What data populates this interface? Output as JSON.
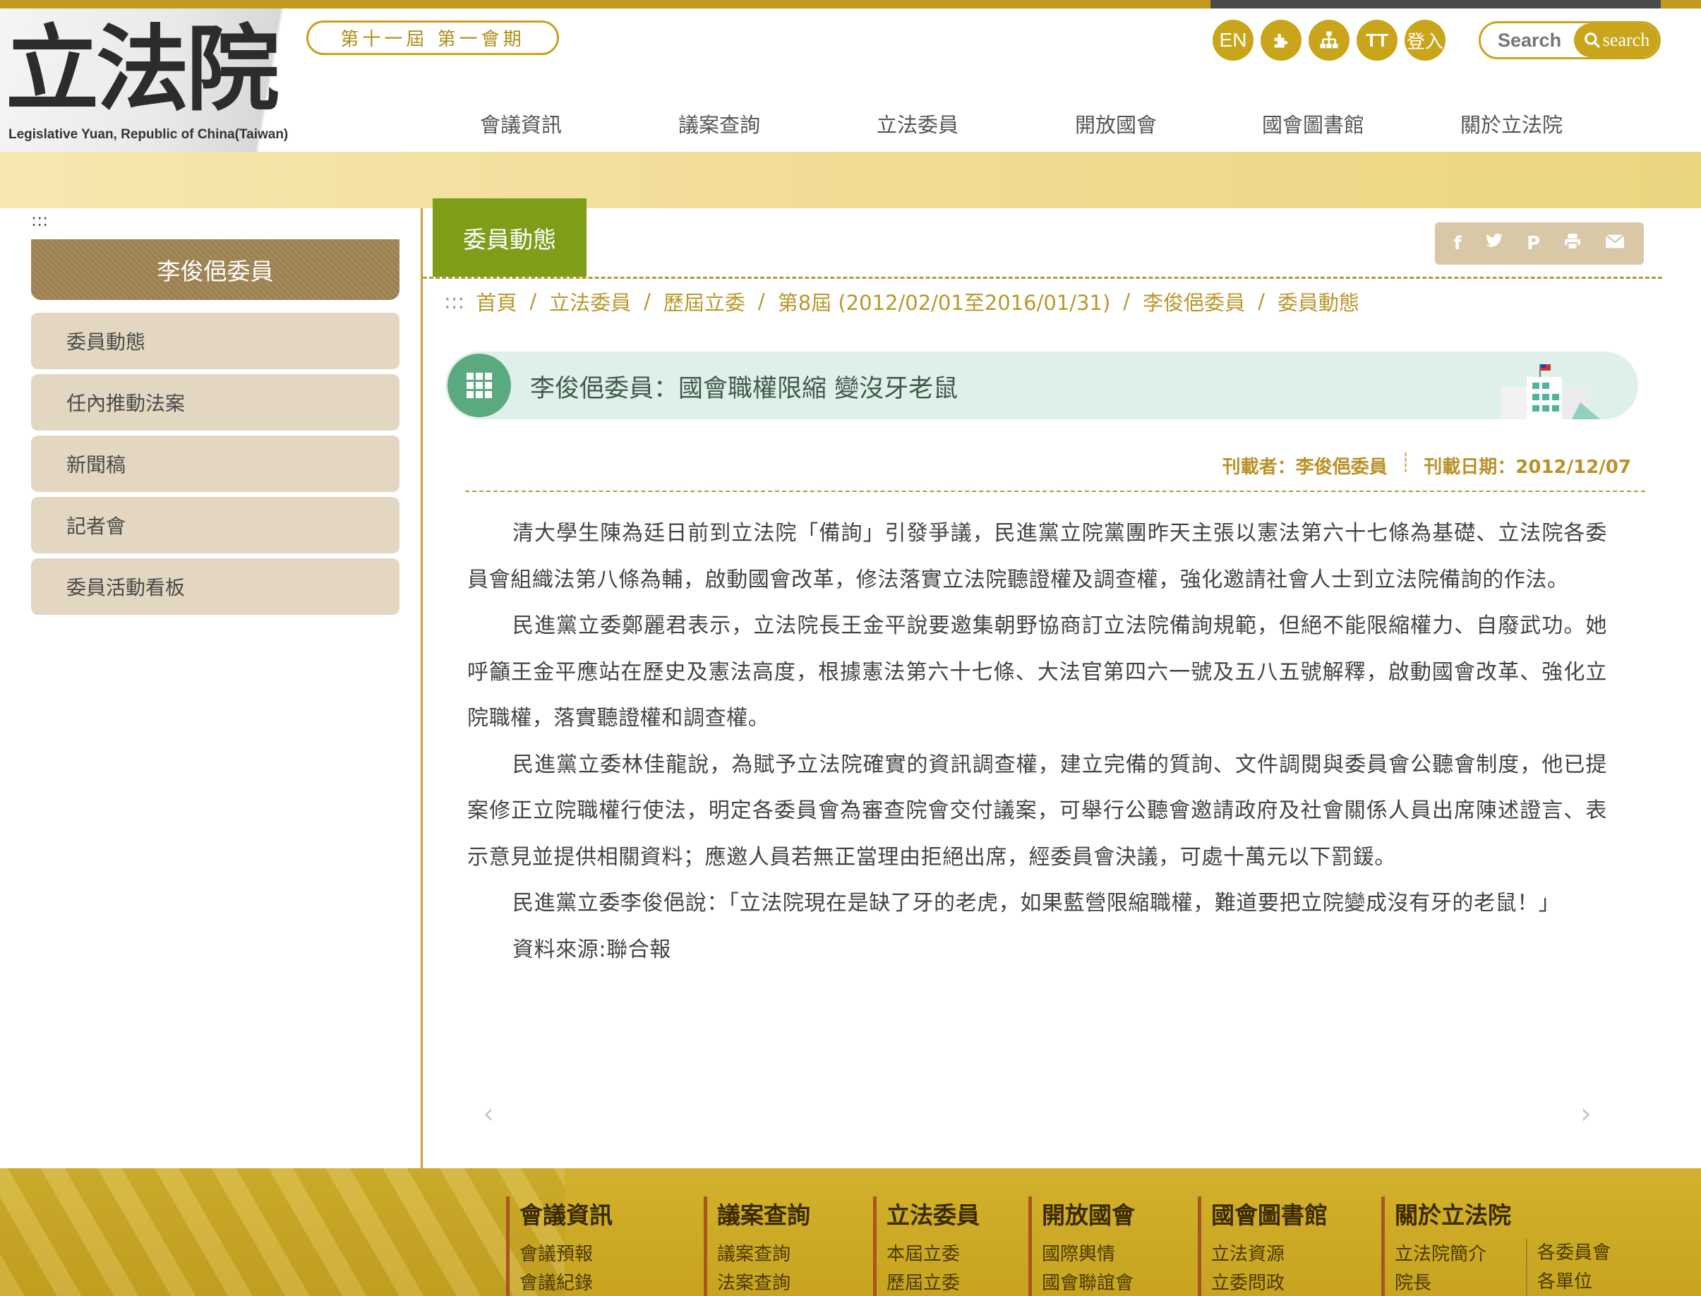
{
  "logo": {
    "chars": "立法院",
    "subtitle": "Legislative Yuan, Republic of China(Taiwan)"
  },
  "session": "第十一屆 第一會期",
  "utility_buttons": [
    {
      "name": "english",
      "label": "EN"
    },
    {
      "name": "accessibility",
      "label": "⚙"
    },
    {
      "name": "sitemap",
      "label": "⛓"
    },
    {
      "name": "font-size",
      "label": "TT"
    },
    {
      "name": "login",
      "label": "登入"
    }
  ],
  "search": {
    "placeholder": "Search",
    "button_label": "search"
  },
  "main_nav": [
    "會議資訊",
    "議案查詢",
    "立法委員",
    "開放國會",
    "國會圖書館",
    "關於立法院"
  ],
  "sidebar": {
    "skip_marker": ":::",
    "title": "李俊俋委員",
    "items": [
      "委員動態",
      "任內推動法案",
      "新聞稿",
      "記者會",
      "委員活動看板"
    ]
  },
  "section_tab": "委員動態",
  "share_icons": [
    "facebook-icon",
    "twitter-icon",
    "plurk-icon",
    "print-icon",
    "email-icon"
  ],
  "breadcrumb": {
    "marker": ":::",
    "items": [
      "首頁",
      "立法委員",
      "歷屆立委",
      "第8屆 (2012/02/01至2016/01/31)",
      "李俊俋委員",
      "委員動態"
    ],
    "separator": "/"
  },
  "article": {
    "title": "李俊俋委員：國會職權限縮 變沒牙老鼠",
    "author_label": "刊載者：李俊俋委員",
    "date_label": "刊載日期：2012/12/07",
    "paragraphs": [
      "清大學生陳為廷日前到立法院「備詢」引發爭議，民進黨立院黨團昨天主張以憲法第六十七條為基礎、立法院各委員會組織法第八條為輔，啟動國會改革，修法落實立法院聽證權及調查權，強化邀請社會人士到立法院備詢的作法。",
      "民進黨立委鄭麗君表示，立法院長王金平說要邀集朝野協商訂立法院備詢規範，但絕不能限縮權力、自廢武功。她呼籲王金平應站在歷史及憲法高度，根據憲法第六十七條、大法官第四六一號及五八五號解釋，啟動國會改革、強化立院職權，落實聽證權和調查權。",
      "民進黨立委林佳龍說，為賦予立法院確實的資訊調查權，建立完備的質詢、文件調閱與委員會公聽會制度，他已提案修正立院職權行使法，明定各委員會為審查院會交付議案，可舉行公聽會邀請政府及社會關係人員出席陳述證言、表示意見並提供相關資料；應邀人員若無正當理由拒絕出席，經委員會決議，可處十萬元以下罰鍰。",
      "民進黨立委李俊俋說：「立法院現在是缺了牙的老虎，如果藍營限縮職權，難道要把立院變成沒有牙的老鼠！」",
      "資料來源:聯合報"
    ]
  },
  "pager": {
    "prev": "‹",
    "next": "›"
  },
  "footer": {
    "columns": [
      {
        "title": "會議資訊",
        "links": [
          "會議預報",
          "會議紀錄"
        ]
      },
      {
        "title": "議案查詢",
        "links": [
          "議案查詢",
          "法案查詢"
        ]
      },
      {
        "title": "立法委員",
        "links": [
          "本屆立委",
          "歷屆立委"
        ]
      },
      {
        "title": "開放國會",
        "links": [
          "國際輿情",
          "國會聯誼會"
        ]
      },
      {
        "title": "國會圖書館",
        "links": [
          "立法資源",
          "立委問政"
        ]
      },
      {
        "title": "關於立法院",
        "links": [
          "立法院簡介",
          "院長"
        ],
        "extra_links": [
          "各委員會",
          "各單位"
        ]
      }
    ]
  },
  "colors": {
    "gold": "#c9a51b",
    "green_tab": "#7e9e1a",
    "title_bar": "#dff0ea",
    "sidebar_item": "#e3d7c2",
    "footer": "#c8a420"
  }
}
